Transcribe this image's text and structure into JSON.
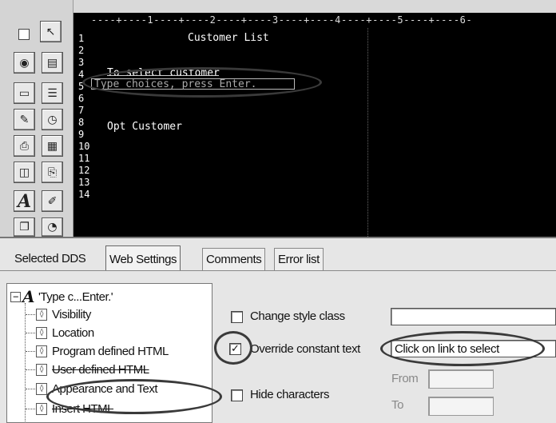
{
  "ruler": "----+----1----+----2----+----3----+----4----+----5----+----6-",
  "screen": {
    "line_numbers": [
      "1",
      "2",
      "3",
      "4",
      "5",
      "6",
      "7",
      "8",
      "9",
      "10",
      "11",
      "12",
      "13",
      "14"
    ],
    "title": "Customer List",
    "line3": "To select customer",
    "line4": "Type choices, press Enter.",
    "line7": "Opt Customer"
  },
  "palette": {
    "icons": [
      "checkbox-tool",
      "pointer-icon",
      "globe-icon",
      "page-icon",
      "rectangle-icon",
      "list-icon",
      "edit-icon",
      "clock-icon",
      "printer-icon",
      "form-icon",
      "window-icon",
      "page-add-icon",
      "text-a-icon",
      "note-icon",
      "page-copy-icon",
      "clock-small-icon"
    ],
    "big_a": "A"
  },
  "tabs": [
    "Selected DDS",
    "Web Settings",
    "Comments",
    "Error list"
  ],
  "active_tab": "Web Settings",
  "tree": {
    "root": "'Type c...Enter.'",
    "items": [
      "Visibility",
      "Location",
      "Program defined HTML",
      "User defined HTML",
      "Appearance and Text",
      "Insert HTML"
    ]
  },
  "settings": {
    "change_style_class": {
      "label": "Change style class",
      "checked": false,
      "value": ""
    },
    "override_constant_text": {
      "label": "Override constant text",
      "checked": true,
      "value": "Click on link to select"
    },
    "hide_characters": {
      "label": "Hide characters",
      "checked": false
    },
    "from_label": "From",
    "to_label": "To"
  }
}
